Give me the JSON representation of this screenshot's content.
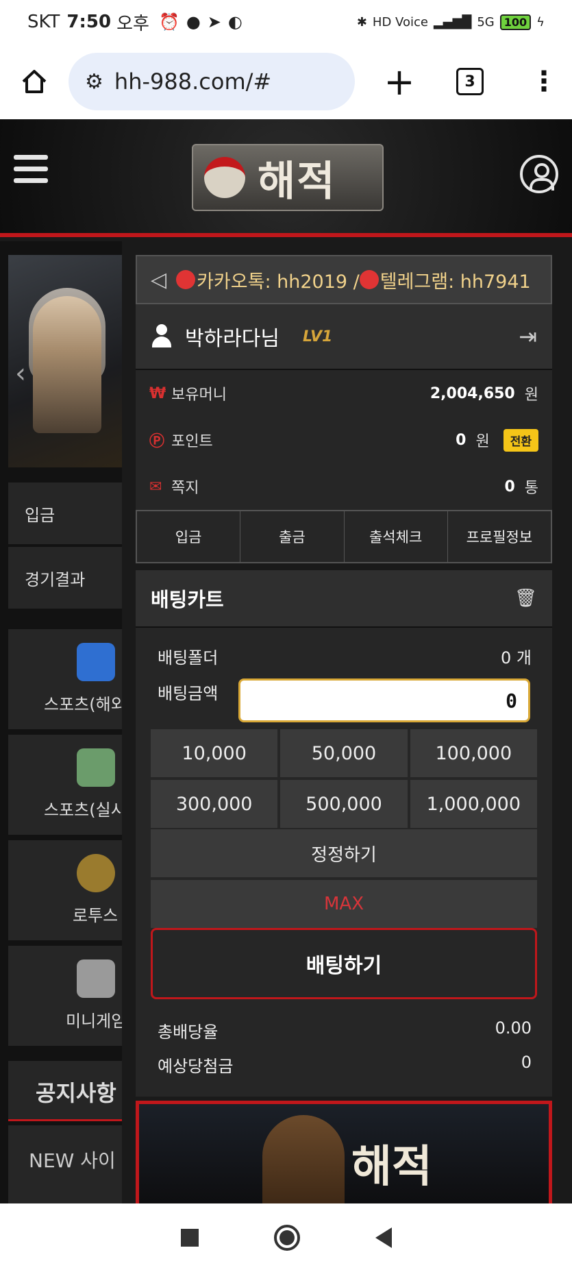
{
  "status_bar": {
    "carrier": "SKT",
    "time": "7:50",
    "ampm": "오후",
    "icons": [
      "alarm-icon",
      "chat-icon",
      "telegram-icon",
      "app-icon"
    ],
    "right_icons": [
      "bluetooth-icon",
      "hd-voice-icon",
      "signal-icon",
      "5g-icon"
    ],
    "hd_voice": "HD Voice",
    "network": "5G",
    "battery": "100"
  },
  "browser": {
    "url": "hh-988.com/#",
    "tab_count": "3"
  },
  "site": {
    "logo_text": "해적",
    "announcement": "카카오톡: hh2019 / ",
    "announcement_2": "텔레그램: hh7941"
  },
  "sidebar": {
    "items": [
      {
        "label": "입금"
      },
      {
        "label": "경기결과"
      }
    ],
    "games": [
      {
        "label": "스포츠(해외",
        "icon": "whistle-ball-icon"
      },
      {
        "label": "스포츠(실시",
        "icon": "phone-ball-icon"
      },
      {
        "label": "로투스",
        "icon": "lotus-gaming-icon"
      },
      {
        "label": "미니게임",
        "icon": "film-icon"
      }
    ],
    "notice_title": "공지사항",
    "notice_item": "NEW 사이"
  },
  "user": {
    "name": "박하라다님",
    "level": "LV1",
    "money_label": "보유머니",
    "money_value": "2,004,650",
    "money_unit": "원",
    "point_label": "포인트",
    "point_value": "0",
    "point_unit": "원",
    "convert_label": "전환",
    "message_label": "쪽지",
    "message_value": "0",
    "message_unit": "통"
  },
  "quick_buttons": [
    "입금",
    "출금",
    "출석체크",
    "프로필정보"
  ],
  "bet_cart": {
    "title": "배팅카트",
    "folder_label": "배팅폴더",
    "folder_value": "0 개",
    "amount_label": "배팅금액",
    "amount_value": "0",
    "amounts": [
      "10,000",
      "50,000",
      "100,000",
      "300,000",
      "500,000",
      "1,000,000"
    ],
    "reset_label": "정정하기",
    "max_label": "MAX",
    "bet_label": "배팅하기",
    "total_odds_label": "총배당율",
    "total_odds_value": "0.00",
    "expected_label": "예상당첨금",
    "expected_value": "0"
  },
  "banner": {
    "text": "해적"
  },
  "colors": {
    "accent_red": "#c0171b",
    "gold": "#f5c518",
    "panel_bg": "#262626"
  }
}
